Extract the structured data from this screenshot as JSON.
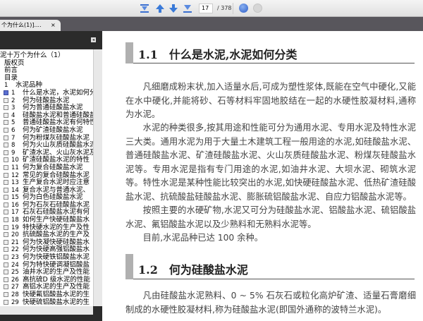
{
  "toolbar": {
    "first_page": "first-page",
    "prev_page": "prev-page",
    "next_page": "next-page",
    "last_page": "last-page",
    "page_current": "17",
    "page_total": "/ 378"
  },
  "tab": {
    "title": "个为什么(1)]....",
    "close": "×"
  },
  "sidebar": {
    "collapse": "◂",
    "items": [
      {
        "num": "",
        "label": "泥十万个为什么（1）",
        "level": 0
      },
      {
        "num": "",
        "label": "版权页",
        "level": 1
      },
      {
        "num": "",
        "label": "前言",
        "level": 1
      },
      {
        "num": "",
        "label": "目录",
        "level": 1
      },
      {
        "num": "1",
        "label": "水泥品种",
        "level": 1
      },
      {
        "num": "1",
        "label": "什么是水泥，水泥如何分类",
        "level": 2,
        "selected": true
      },
      {
        "num": "2",
        "label": "何为硅酸盐水泥",
        "level": 2
      },
      {
        "num": "3",
        "label": "何为普通硅酸盐水泥",
        "level": 2
      },
      {
        "num": "4",
        "label": "硅酸盐水泥和普通硅酸盐",
        "level": 2
      },
      {
        "num": "5",
        "label": "普通硅酸盐水泥有何特性",
        "level": 2
      },
      {
        "num": "6",
        "label": "何为矿渣硅酸盐水泥",
        "level": 2
      },
      {
        "num": "7",
        "label": "何为粉煤灰硅酸盐水泥",
        "level": 2
      },
      {
        "num": "8",
        "label": "何为火山灰质硅酸盐水泥",
        "level": 2
      },
      {
        "num": "9",
        "label": "矿渣水泥、火山灰水泥及",
        "level": 2
      },
      {
        "num": "10",
        "label": "矿渣硅酸盐水泥的特性",
        "level": 2
      },
      {
        "num": "11",
        "label": "何为复合硅酸盐水泥",
        "level": 2
      },
      {
        "num": "12",
        "label": "常见的复合硅酸盐水泥",
        "level": 2
      },
      {
        "num": "13",
        "label": "生产复合水泥时应注意",
        "level": 2
      },
      {
        "num": "14",
        "label": "复合水泥与普通水泥、",
        "level": 2
      },
      {
        "num": "15",
        "label": "何为白色硅酸盐水泥",
        "level": 2
      },
      {
        "num": "16",
        "label": "何为石灰石硅酸盐水泥",
        "level": 2
      },
      {
        "num": "17",
        "label": "石灰石硅酸盐水泥有何",
        "level": 2
      },
      {
        "num": "18",
        "label": "如何生产快硬硅酸盐水",
        "level": 2
      },
      {
        "num": "19",
        "label": "特快硬水泥的生产及性",
        "level": 2
      },
      {
        "num": "20",
        "label": "抗硫酸盐水泥的生产及",
        "level": 2
      },
      {
        "num": "21",
        "label": "何为快凝快硬硅酸盐水",
        "level": 2
      },
      {
        "num": "22",
        "label": "何为快硬高强铝酸盐水",
        "level": 2
      },
      {
        "num": "23",
        "label": "何为快硬铁铝酸盐水泥",
        "level": 2
      },
      {
        "num": "24",
        "label": "何为特快硬调凝铝酸盐",
        "level": 2
      },
      {
        "num": "25",
        "label": "油井水泥的生产及性能",
        "level": 2
      },
      {
        "num": "26",
        "label": "高抗硫D 级水泥的性能",
        "level": 2
      },
      {
        "num": "27",
        "label": "高铝水泥的生产及性能",
        "level": 2
      },
      {
        "num": "28",
        "label": "快硬氟铝酸盐水泥的生",
        "level": 2
      },
      {
        "num": "29",
        "label": "快硬硫铝酸盐水泥的生",
        "level": 2
      }
    ]
  },
  "doc": {
    "h1": "1.1　什么是水泥,水泥如何分类",
    "p1": "凡细磨成粉末状,加入适量水后,可成为塑性浆体,既能在空气中硬化,又能在水中硬化,并能将砂、石等材料牢固地胶结在一起的水硬性胶凝材料,通称为水泥。",
    "p2": "水泥的种类很多,按其用途和性能可分为通用水泥、专用水泥及特性水泥三大类。通用水泥为用于大量土木建筑工程一般用途的水泥,如硅酸盐水泥、普通硅酸盐水泥、矿渣硅酸盐水泥、火山灰质硅酸盐水泥、粉煤灰硅酸盐水泥等。专用水泥是指有专门用途的水泥,如油井水泥、大坝水泥、砌筑水泥等。特性水泥是某种性能比较突出的水泥,如快硬硅酸盐水泥、低热矿渣硅酸盐水泥、抗硫酸盐硅酸盐水泥、膨胀硫铝酸盐水泥、自应力铝酸盐水泥等。",
    "p3": "按照主要的水硬矿物,水泥又可分为硅酸盐水泥、铝酸盐水泥、硫铝酸盐水泥、氟铝酸盐水泥以及少熟料和无熟料水泥等。",
    "p4": "目前,水泥品种已达 100 余种。",
    "h2": "1.2　何为硅酸盐水泥",
    "p5": "凡由硅酸盐水泥熟料、0 ~ 5% 石灰石或粒化高炉矿渣、适量石膏磨细制成的水硬性胶凝材料,称为硅酸盐水泥(即国外通称的波特兰水泥)。"
  }
}
